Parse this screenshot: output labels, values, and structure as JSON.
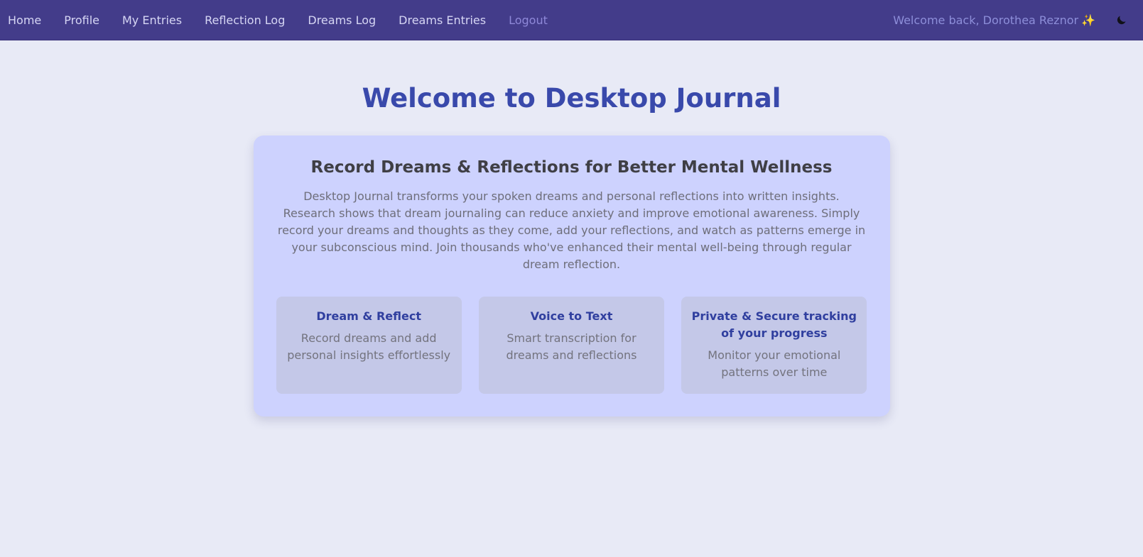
{
  "nav": {
    "links": [
      {
        "label": "Home"
      },
      {
        "label": "Profile"
      },
      {
        "label": "My Entries"
      },
      {
        "label": "Reflection Log"
      },
      {
        "label": "Dreams Log"
      },
      {
        "label": "Dreams Entries"
      },
      {
        "label": "Logout"
      }
    ],
    "welcome": "Welcome back, Dorothea Reznor",
    "sparkle": "✨",
    "theme_toggle_icon": "moon-icon"
  },
  "main": {
    "title": "Welcome to Desktop Journal",
    "card": {
      "heading": "Record Dreams & Reflections for Better Mental Wellness",
      "description": "Desktop Journal transforms your spoken dreams and personal reflections into written insights. Research shows that dream journaling can reduce anxiety and improve emotional awareness. Simply record your dreams and thoughts as they come, add your reflections, and watch as patterns emerge in your subconscious mind. Join thousands who've enhanced their mental well-being through regular dream reflection.",
      "features": [
        {
          "title": "Dream & Reflect",
          "description": "Record dreams and add personal insights effortlessly"
        },
        {
          "title": "Voice to Text",
          "description": "Smart transcription for dreams and reflections"
        },
        {
          "title": "Private & Secure tracking of your progress",
          "description": "Monitor your emotional patterns over time"
        }
      ]
    }
  },
  "colors": {
    "navbar_bg": "#433c8a",
    "page_bg": "#e8eaf6",
    "title": "#3949ab",
    "card_bg": "#cdd2fe",
    "feature_bg": "#c4c8e8",
    "feature_title": "#303f9f"
  }
}
